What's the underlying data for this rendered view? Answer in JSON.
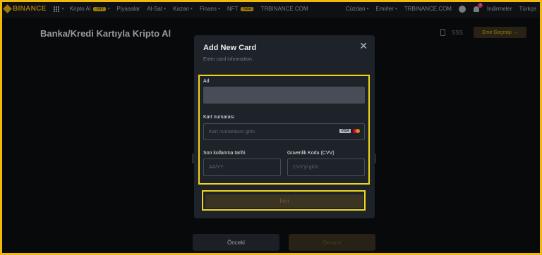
{
  "nav": {
    "logo": "BINANCE",
    "items": [
      {
        "label": "Kripto Al",
        "badge": "TRY",
        "caret": true
      },
      {
        "label": "Piyasalar",
        "caret": false
      },
      {
        "label": "Al-Sat",
        "caret": true
      },
      {
        "label": "Kazan",
        "caret": true
      },
      {
        "label": "Finans",
        "caret": true
      },
      {
        "label": "NFT",
        "badge": "New",
        "caret": false
      },
      {
        "label": "TRBINANCE.COM",
        "caret": false
      }
    ],
    "right": {
      "wallet": "Cüzdan",
      "orders": "Emirler",
      "trbinance": "TRBINANCE.COM",
      "notification_count": "1",
      "downloads": "İndirmeler",
      "language": "Türkçe"
    }
  },
  "page": {
    "title": "Banka/Kredi Kartıyla Kripto Al",
    "faq": "SSS",
    "history_button": "Emir Geçmişi →",
    "prev_button": "Önceki",
    "next_button": "Devam"
  },
  "modal": {
    "title": "Add New Card",
    "subtitle": "Enter card information.",
    "close": "✕",
    "name_label": "Ad",
    "name_value": "",
    "card_number_label": "Kart numarası",
    "card_number_placeholder": "Kart numarasını girin",
    "card_brand_visa": "VISA",
    "expiry_label": "Son kullanma tarihi",
    "expiry_placeholder": "AA/YY",
    "cvv_label": "Güvenlik Kodu (CVV)",
    "cvv_placeholder": "CVV'yi girin",
    "next_button": "İleri"
  },
  "colors": {
    "accent": "#f0b90b",
    "highlight": "#f0d51c",
    "background": "#0b0e11",
    "modal": "#1e2329"
  }
}
